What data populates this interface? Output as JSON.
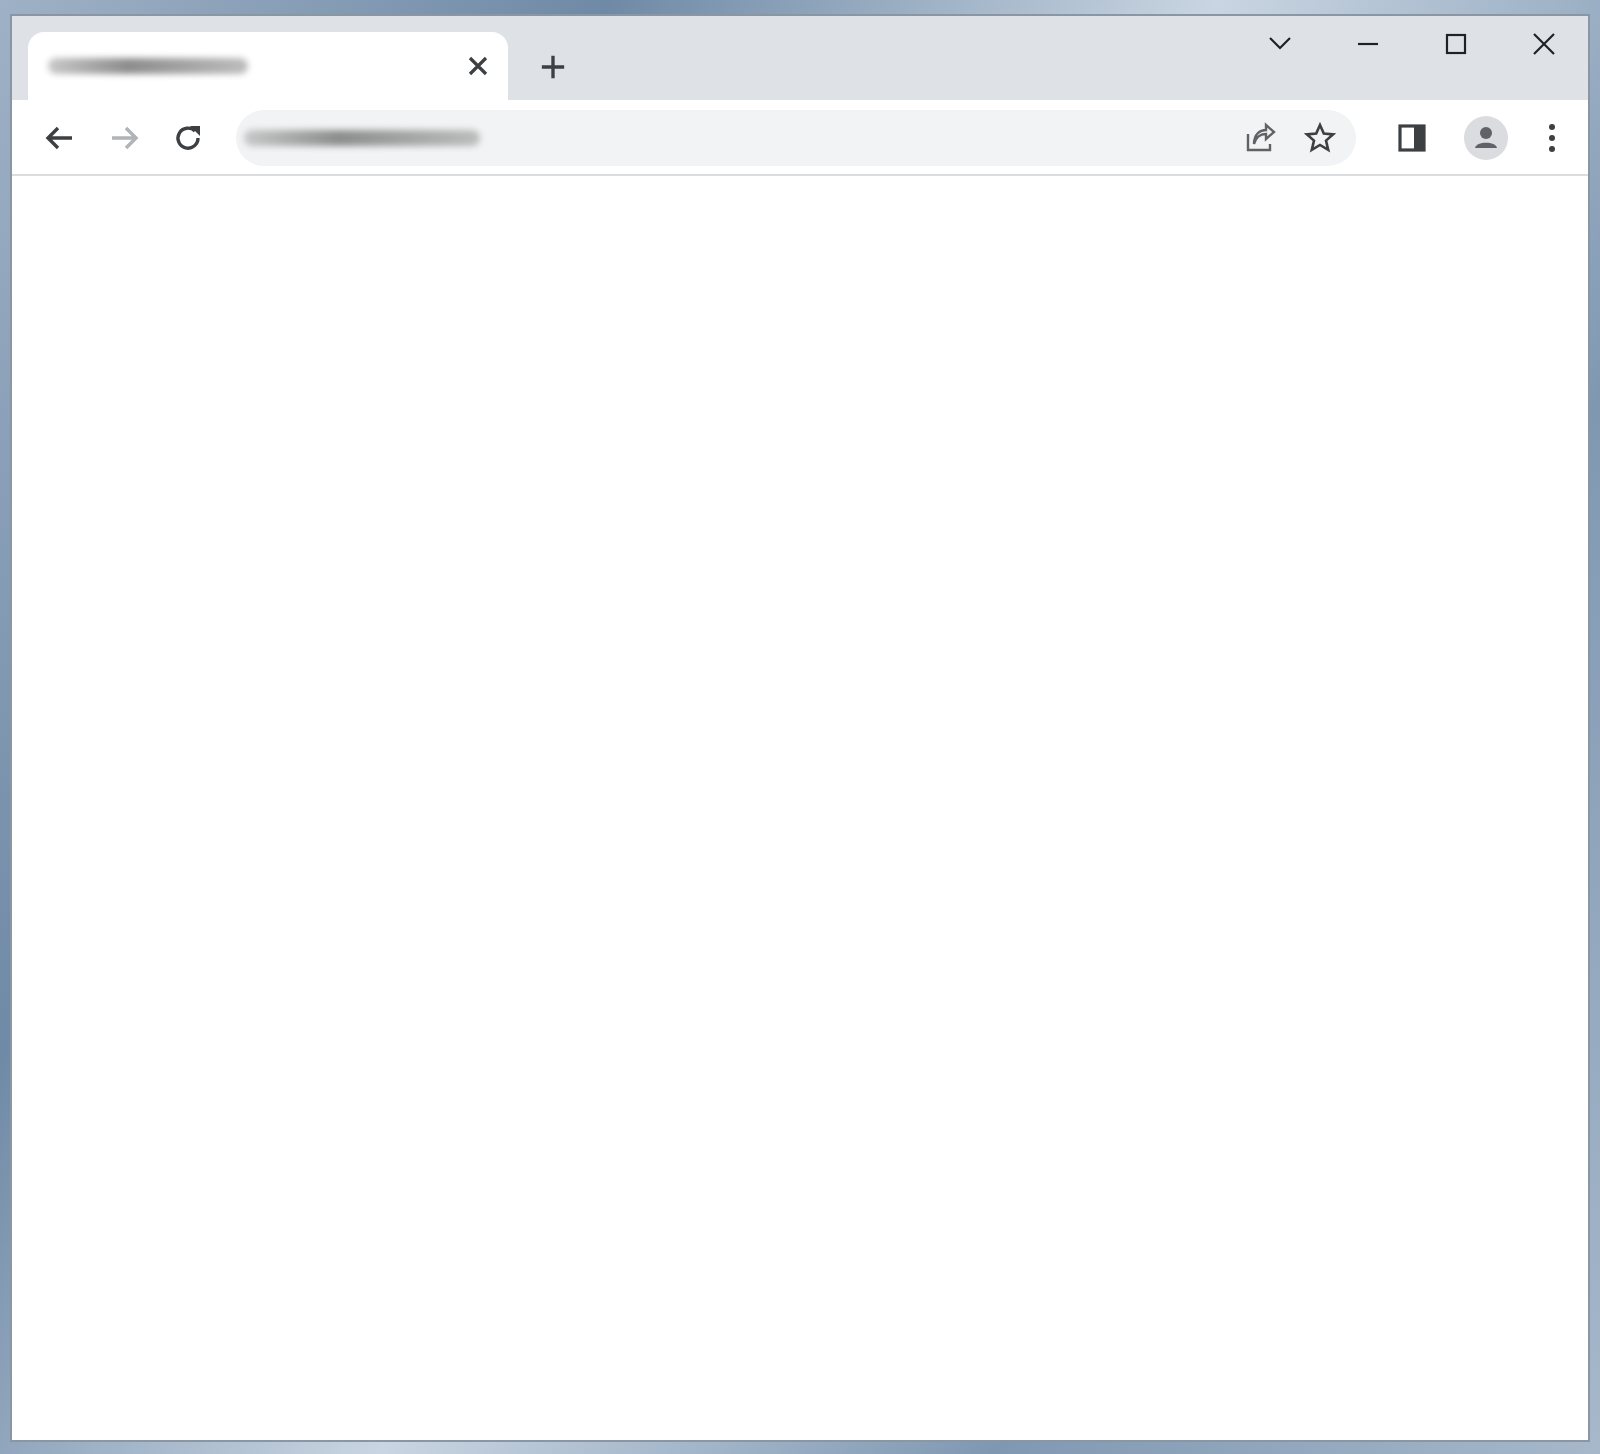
{
  "tabs": [
    {
      "selected": true
    }
  ],
  "toolbar": {
    "forward_disabled": true
  }
}
